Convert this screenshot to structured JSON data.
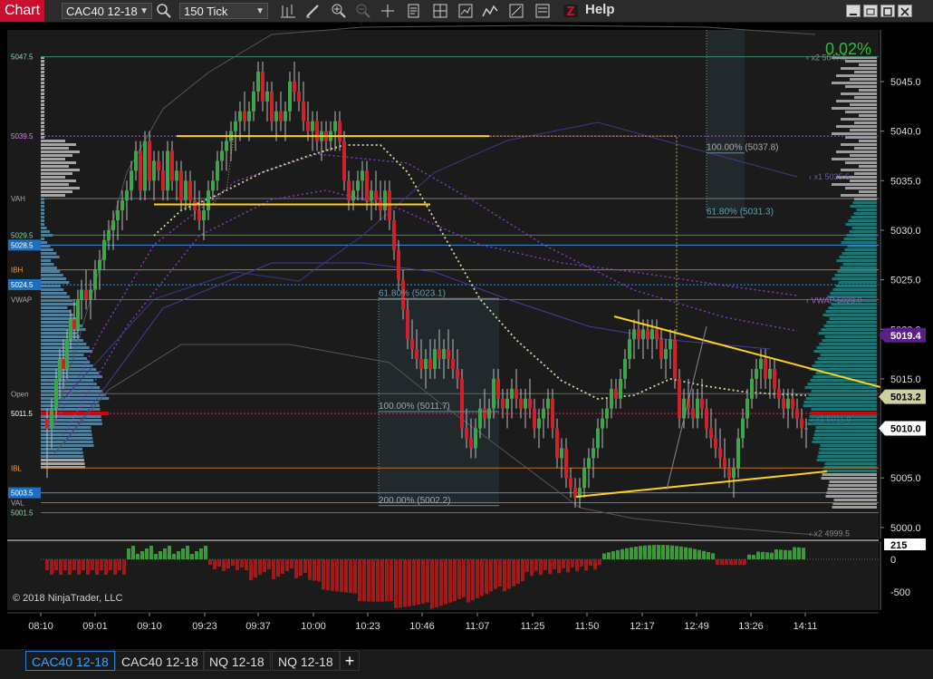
{
  "app": {
    "title": "Chart",
    "help": "Help"
  },
  "toolbar": {
    "instrument": "CAC40 12-18",
    "period": "150 Tick",
    "icons": [
      "search-icon",
      "bar-type-icon",
      "draw-icon",
      "zoom-in-icon",
      "zoom-out-icon",
      "crosshair-icon",
      "properties-icon",
      "data-box-icon",
      "chart-trader-icon",
      "indicators-icon",
      "strategies-icon",
      "templates-icon",
      "zigzag-icon"
    ]
  },
  "chart": {
    "percent_change": "0.02%",
    "copyright": "© 2018 NinjaTrader, LLC",
    "fib_levels_left": [
      {
        "label": "61.80% (5023.1)",
        "price": 5023.1
      },
      {
        "label": "100.00% (5011.7)",
        "price": 5011.7
      },
      {
        "label": "200.00% (5002.2)",
        "price": 5002.2
      }
    ],
    "fib_levels_right": [
      {
        "label": "100.00% (5037.8)",
        "price": 5037.8
      },
      {
        "label": "61.80% (5031.3)",
        "price": 5031.3
      }
    ],
    "ref_tags": [
      {
        "label": "x2 5047.5",
        "price": 5047.5
      },
      {
        "label": "x1 5035.5",
        "price": 5035.5
      },
      {
        "label": "VWAP 5023.0",
        "price": 5023.0
      },
      {
        "label": "x1 5011.0",
        "price": 5011.0
      },
      {
        "label": "x2 4999.5",
        "price": 4999.5
      }
    ],
    "left_labels": [
      {
        "text": "5047.5",
        "price": 5047.5,
        "color": "#7fe0a0",
        "boxed": false
      },
      {
        "text": "5039.5",
        "price": 5039.5,
        "color": "#d08ae0",
        "boxed": false
      },
      {
        "text": "VAH",
        "price": 5033.2,
        "color": "#aaaaaa",
        "boxed": false
      },
      {
        "text": "5029.5",
        "price": 5029.5,
        "color": "#7fe0a0",
        "boxed": false
      },
      {
        "text": "5028.5",
        "price": 5028.5,
        "color": "#ffffff",
        "boxed": true
      },
      {
        "text": "IBH",
        "price": 5026.0,
        "color": "#ff9933",
        "boxed": false
      },
      {
        "text": "5024.5",
        "price": 5024.5,
        "color": "#ffffff",
        "boxed": true
      },
      {
        "text": "VWAP",
        "price": 5023.0,
        "color": "#aaaaaa",
        "boxed": false
      },
      {
        "text": "Open",
        "price": 5013.5,
        "color": "#aaaaaa",
        "boxed": false
      },
      {
        "text": "5011.5",
        "price": 5011.5,
        "color": "#ffffff",
        "boxed": false
      },
      {
        "text": "IBL",
        "price": 5006.0,
        "color": "#ff9933",
        "boxed": false
      },
      {
        "text": "5003.5",
        "price": 5003.5,
        "color": "#ffffff",
        "boxed": true
      },
      {
        "text": "VAL",
        "price": 5002.5,
        "color": "#aaaaaa",
        "boxed": false
      },
      {
        "text": "5001.5",
        "price": 5001.5,
        "color": "#7fe0a0",
        "boxed": false
      }
    ],
    "price_axis": [
      "5045.0",
      "5040.0",
      "5035.0",
      "5030.0",
      "5025.0",
      "5020.0",
      "5015.0",
      "5010.0",
      "5005.0",
      "5000.0"
    ],
    "markers": [
      {
        "text": "5019.4",
        "price": 5019.4,
        "bg": "#5b1f8a",
        "color": "#ffffff"
      },
      {
        "text": "5013.2",
        "price": 5013.2,
        "bg": "#cfcfa0",
        "color": "#000000"
      },
      {
        "text": "5010.0",
        "price": 5010.0,
        "bg": "#ffffff",
        "color": "#000000"
      }
    ],
    "volume_axis": [
      "215",
      "0",
      "-500"
    ],
    "time_axis": [
      "08:10",
      "09:01",
      "09:10",
      "09:23",
      "09:37",
      "10:00",
      "10:23",
      "10:46",
      "11:07",
      "11:25",
      "11:50",
      "12:17",
      "12:49",
      "13:26",
      "14:11"
    ]
  },
  "tabs": [
    {
      "label": "CAC40 12-18",
      "active": true
    },
    {
      "label": "CAC40 12-18",
      "active": false
    },
    {
      "label": "NQ 12-18",
      "active": false
    },
    {
      "label": "NQ 12-18",
      "active": false
    }
  ],
  "colors": {
    "accent": "#c8102e",
    "up": "#3aa84a",
    "down": "#d0202a",
    "trendline": "#ffd21a"
  }
}
